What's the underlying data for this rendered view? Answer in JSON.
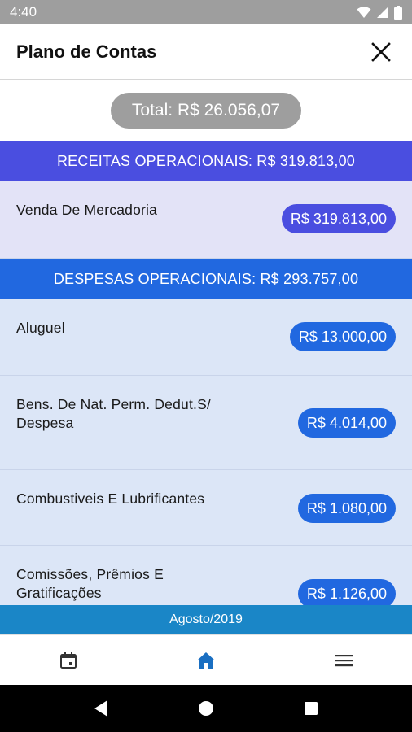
{
  "status_bar": {
    "time": "4:40",
    "icons": [
      "wifi-icon",
      "signal-icon",
      "battery-icon"
    ]
  },
  "app_bar": {
    "title": "Plano de Contas",
    "close_icon": "close-icon"
  },
  "total": {
    "text": "Total: R$ 26.056,07"
  },
  "sections": [
    {
      "header": "RECEITAS OPERACIONAIS: R$ 319.813,00",
      "items": [
        {
          "label": "Venda De Mercadoria",
          "amount": "R$ 319.813,00"
        }
      ]
    },
    {
      "header": "DESPESAS OPERACIONAIS: R$ 293.757,00",
      "items": [
        {
          "label": "Aluguel",
          "amount": "R$ 13.000,00"
        },
        {
          "label": "Bens. De Nat. Perm. Dedut.S/ Despesa",
          "amount": "R$ 4.014,00"
        },
        {
          "label": "Combustiveis E Lubrificantes",
          "amount": "R$ 1.080,00"
        },
        {
          "label": "Comissões, Prêmios E Gratificações",
          "amount": "R$ 1.126,00"
        }
      ]
    }
  ],
  "month_bar": {
    "text": "Agosto/2019"
  },
  "bottom_nav": {
    "items": [
      {
        "icon": "calendar-icon",
        "active": false
      },
      {
        "icon": "home-icon",
        "active": true
      },
      {
        "icon": "menu-icon",
        "active": false
      }
    ],
    "active_color": "#1a6fc2",
    "inactive_color": "#333333"
  },
  "colors": {
    "receitas": "#4a4ee0",
    "despesas": "#2168e0",
    "month_bar": "#1a86c7",
    "total_pill": "#9e9e9e"
  }
}
